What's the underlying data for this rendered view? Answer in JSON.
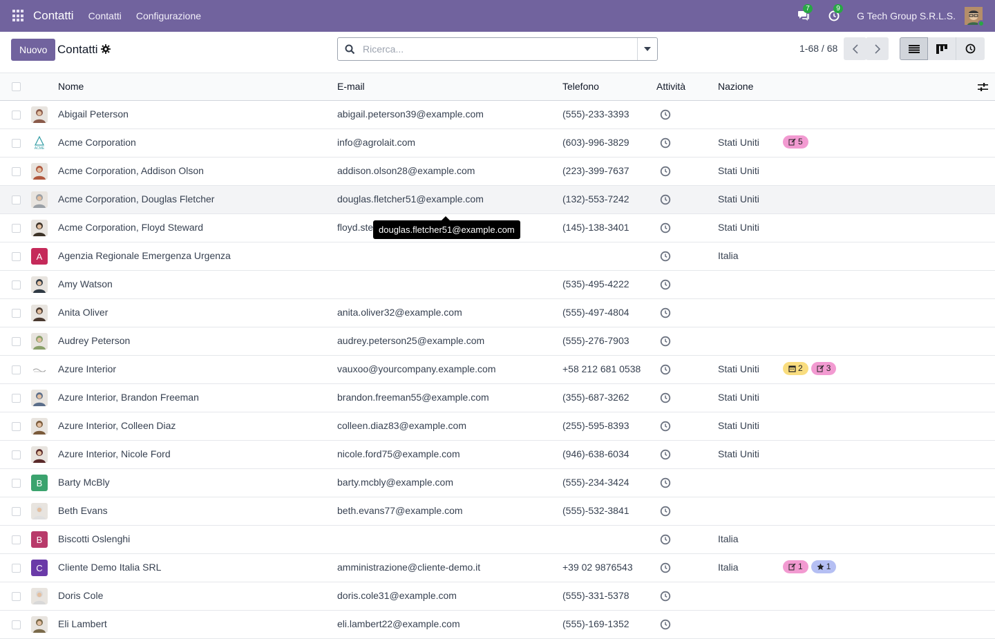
{
  "navbar": {
    "brand": "Contatti",
    "menu": [
      "Contatti",
      "Configurazione"
    ],
    "messages_badge": "7",
    "activities_badge": "9",
    "company": "G Tech Group S.R.L.S.",
    "color": "#71639e"
  },
  "control_panel": {
    "new_label": "Nuovo",
    "title": "Contatti",
    "search_placeholder": "Ricerca...",
    "pager": "1-68 / 68"
  },
  "table": {
    "headers": {
      "name": "Nome",
      "email": "E-mail",
      "phone": "Telefono",
      "activity": "Attività",
      "country": "Nazione"
    },
    "rows": [
      {
        "name": "Abigail Peterson",
        "email": "abigail.peterson39@example.com",
        "phone": "(555)-233-3393",
        "country": "",
        "avatar": "photo",
        "avatar_color": "#8a5a4a"
      },
      {
        "name": "Acme Corporation",
        "email": "info@agrolait.com",
        "phone": "(603)-996-3829",
        "country": "Stati Uniti",
        "avatar": "logo",
        "tags": [
          {
            "icon": "edit",
            "count": "5",
            "color": "pink"
          }
        ]
      },
      {
        "name": "Acme Corporation, Addison Olson",
        "email": "addison.olson28@example.com",
        "phone": "(223)-399-7637",
        "country": "Stati Uniti",
        "avatar": "photo",
        "avatar_color": "#b0583e"
      },
      {
        "name": "Acme Corporation, Douglas Fletcher",
        "email": "douglas.fletcher51@example.com",
        "phone": "(132)-553-7242",
        "country": "Stati Uniti",
        "avatar": "photo",
        "avatar_color": "#9aa0a6",
        "hover": true
      },
      {
        "name": "Acme Corporation, Floyd Steward",
        "email": "floyd.steward34@example.com",
        "phone": "(145)-138-3401",
        "country": "Stati Uniti",
        "avatar": "photo",
        "avatar_color": "#3d3328"
      },
      {
        "name": "Agenzia Regionale Emergenza Urgenza",
        "email": "",
        "phone": "",
        "country": "Italia",
        "avatar": "letter",
        "letter": "A",
        "avatar_color": "#c52a5a"
      },
      {
        "name": "Amy Watson",
        "email": "",
        "phone": "(535)-495-4222",
        "country": "",
        "avatar": "photo",
        "avatar_color": "#2f3a44"
      },
      {
        "name": "Anita Oliver",
        "email": "anita.oliver32@example.com",
        "phone": "(555)-497-4804",
        "country": "",
        "avatar": "photo",
        "avatar_color": "#4a3a30"
      },
      {
        "name": "Audrey Peterson",
        "email": "audrey.peterson25@example.com",
        "phone": "(555)-276-7903",
        "country": "",
        "avatar": "photo",
        "avatar_color": "#8aa06a"
      },
      {
        "name": "Azure Interior",
        "email": "vauxoo@yourcompany.example.com",
        "phone": "+58 212 681 0538",
        "country": "Stati Uniti",
        "avatar": "logo2",
        "tags": [
          {
            "icon": "calendar",
            "count": "2",
            "color": "yellow"
          },
          {
            "icon": "edit",
            "count": "3",
            "color": "pink"
          }
        ]
      },
      {
        "name": "Azure Interior, Brandon Freeman",
        "email": "brandon.freeman55@example.com",
        "phone": "(355)-687-3262",
        "country": "Stati Uniti",
        "avatar": "photo",
        "avatar_color": "#5b6e8a"
      },
      {
        "name": "Azure Interior, Colleen Diaz",
        "email": "colleen.diaz83@example.com",
        "phone": "(255)-595-8393",
        "country": "Stati Uniti",
        "avatar": "photo",
        "avatar_color": "#7a5a3a"
      },
      {
        "name": "Azure Interior, Nicole Ford",
        "email": "nicole.ford75@example.com",
        "phone": "(946)-638-6034",
        "country": "Stati Uniti",
        "avatar": "photo",
        "avatar_color": "#5a2a2a"
      },
      {
        "name": "Barty McBly",
        "email": "barty.mcbly@example.com",
        "phone": "(555)-234-3424",
        "country": "",
        "avatar": "letter",
        "letter": "B",
        "avatar_color": "#3ba36e"
      },
      {
        "name": "Beth Evans",
        "email": "beth.evans77@example.com",
        "phone": "(555)-532-3841",
        "country": "",
        "avatar": "photo",
        "avatar_color": "#e0e0e0"
      },
      {
        "name": "Biscotti Oslenghi",
        "email": "",
        "phone": "",
        "country": "Italia",
        "avatar": "letter",
        "letter": "B",
        "avatar_color": "#b83a6a"
      },
      {
        "name": "Cliente Demo Italia SRL",
        "email": "amministrazione@cliente-demo.it",
        "phone": "+39 02 9876543",
        "country": "Italia",
        "avatar": "letter",
        "letter": "C",
        "avatar_color": "#6a3aa8",
        "tags": [
          {
            "icon": "edit",
            "count": "1",
            "color": "pink"
          },
          {
            "icon": "star",
            "count": "1",
            "color": "blue"
          }
        ]
      },
      {
        "name": "Doris Cole",
        "email": "doris.cole31@example.com",
        "phone": "(555)-331-5378",
        "country": "",
        "avatar": "photo",
        "avatar_color": "#d8d8d8"
      },
      {
        "name": "Eli Lambert",
        "email": "eli.lambert22@example.com",
        "phone": "(555)-169-1352",
        "country": "",
        "avatar": "photo",
        "avatar_color": "#7a6a4a"
      }
    ]
  },
  "tooltip": "douglas.fletcher51@example.com"
}
